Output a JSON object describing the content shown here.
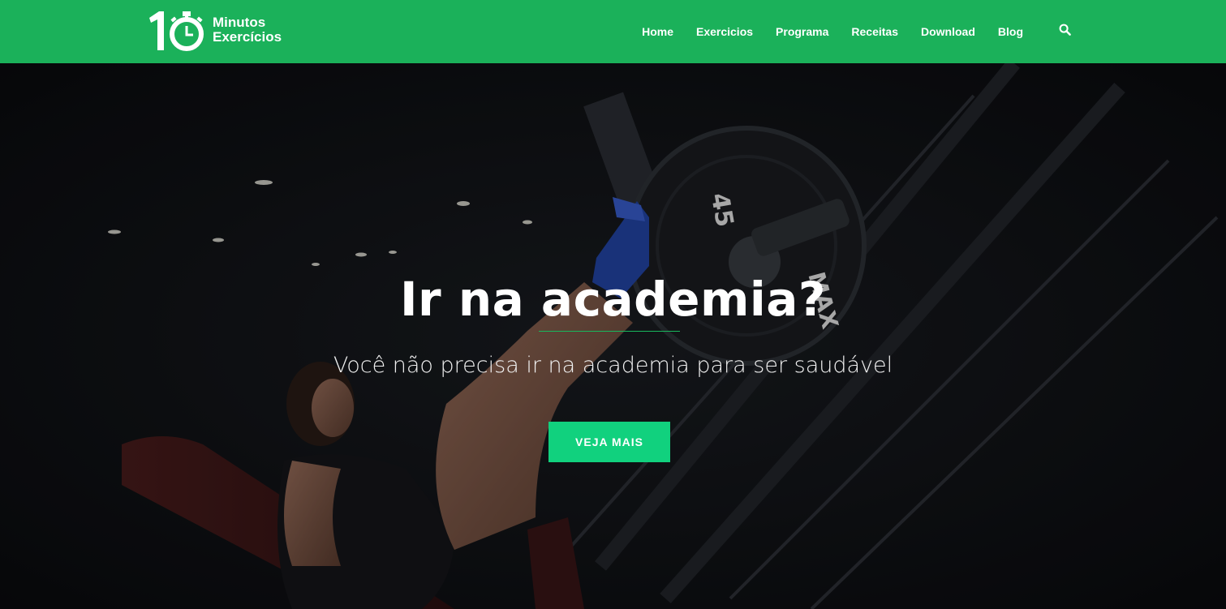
{
  "header": {
    "logo": {
      "number": "10",
      "line1": "Minutos",
      "line2": "Exercícios"
    },
    "nav": [
      {
        "label": "Home"
      },
      {
        "label": "Exercicios"
      },
      {
        "label": "Programa"
      },
      {
        "label": "Receitas"
      },
      {
        "label": "Download"
      },
      {
        "label": "Blog"
      }
    ],
    "search_icon": "search-icon"
  },
  "hero": {
    "title": "Ir na academia?",
    "subtitle": "Você não precisa ir na academia para ser saudável",
    "cta_label": "VEJA MAIS",
    "plate_labels": [
      "45",
      "MAX"
    ]
  },
  "colors": {
    "header_bg": "#1bb15a",
    "cta_bg": "#11d17e",
    "accent_line": "#18b85d",
    "hero_bg": "#111317"
  }
}
